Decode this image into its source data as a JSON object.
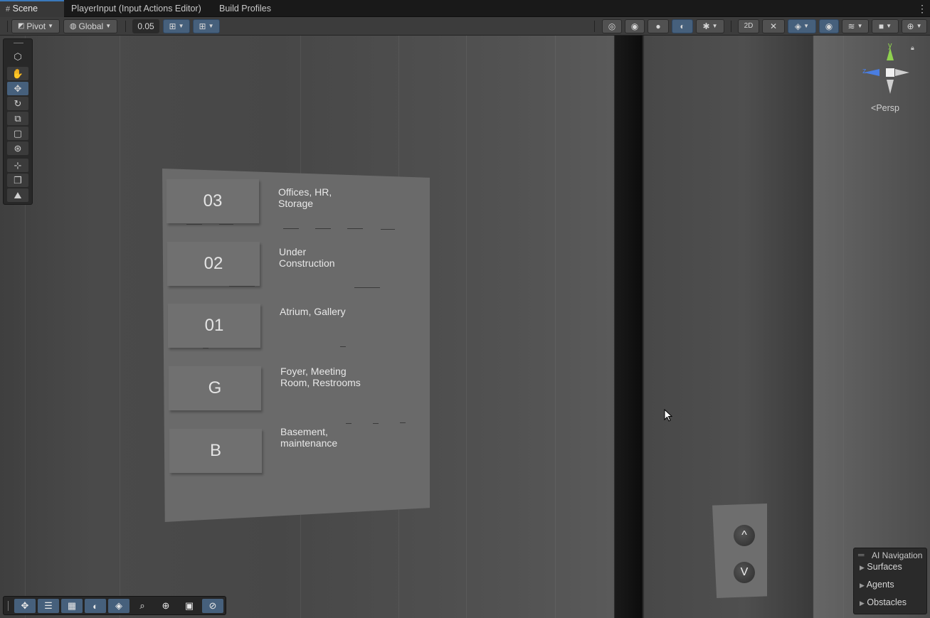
{
  "tabs": [
    {
      "label": "Scene",
      "active": true
    },
    {
      "label": "PlayerInput (Input Actions Editor)",
      "active": false
    },
    {
      "label": "Build Profiles",
      "active": false
    }
  ],
  "toolbar": {
    "pivot_label": "Pivot",
    "global_label": "Global",
    "snap_value": "0.05"
  },
  "scene": {
    "sign": {
      "floors": [
        {
          "number": "03",
          "label_line1": "Offices, HR,",
          "label_line2": "Storage"
        },
        {
          "number": "02",
          "label_line1": "Under",
          "label_line2": "Construction"
        },
        {
          "number": "01",
          "label_line1": "Atrium, Gallery",
          "label_line2": ""
        },
        {
          "number": "G",
          "label_line1": "Foyer, Meeting",
          "label_line2": "Room, Restrooms"
        },
        {
          "number": "B",
          "label_line1": "Basement,",
          "label_line2": "maintenance"
        }
      ]
    },
    "call_panel": {
      "up_label": "^",
      "down_label": "V"
    },
    "gizmo": {
      "y_label": "y",
      "z_label": "z",
      "view_label": "Persp"
    }
  },
  "ai_navigation": {
    "title": "AI Navigation",
    "items": [
      "Surfaces",
      "Agents",
      "Obstacles"
    ]
  },
  "colors": {
    "accent": "#46607c",
    "active_tab_border": "#3a79bb"
  }
}
